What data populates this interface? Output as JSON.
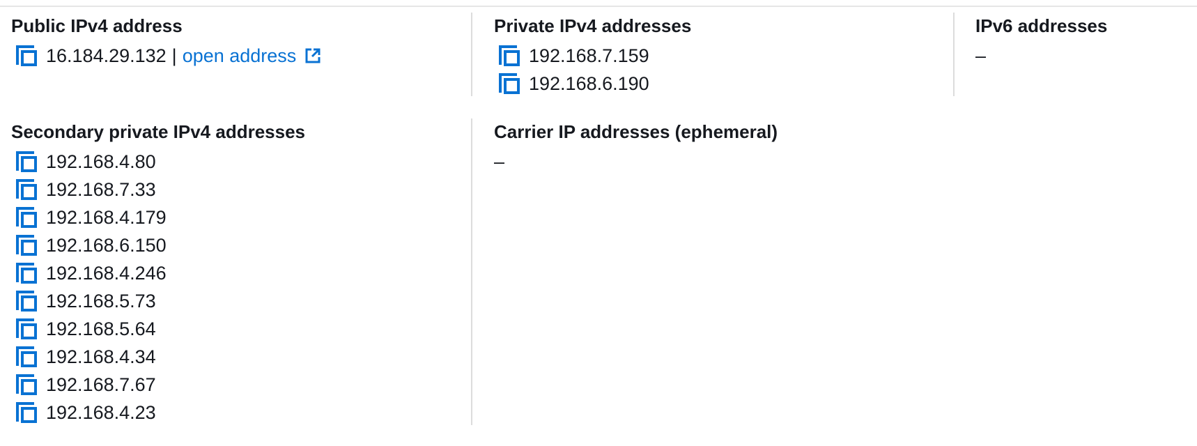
{
  "public_ipv4": {
    "label": "Public IPv4 address",
    "address": "16.184.29.132",
    "separator": "|",
    "link_text": "open address",
    "link_icon": "external-link-icon",
    "copy_icon": "copy-icon"
  },
  "private_ipv4": {
    "label": "Private IPv4 addresses",
    "addresses": [
      "192.168.7.159",
      "192.168.6.190"
    ],
    "copy_icon": "copy-icon"
  },
  "ipv6": {
    "label": "IPv6 addresses",
    "empty_value": "–"
  },
  "secondary_private_ipv4": {
    "label": "Secondary private IPv4 addresses",
    "addresses": [
      "192.168.4.80",
      "192.168.7.33",
      "192.168.4.179",
      "192.168.6.150",
      "192.168.4.246",
      "192.168.5.73",
      "192.168.5.64",
      "192.168.4.34",
      "192.168.7.67",
      "192.168.4.23"
    ],
    "copy_icon": "copy-icon"
  },
  "carrier_ip": {
    "label": "Carrier IP addresses (ephemeral)",
    "empty_value": "–"
  },
  "colors": {
    "text": "#16191f",
    "link": "#0972d3",
    "icon": "#0972d3",
    "divider": "#dcdcdc"
  }
}
